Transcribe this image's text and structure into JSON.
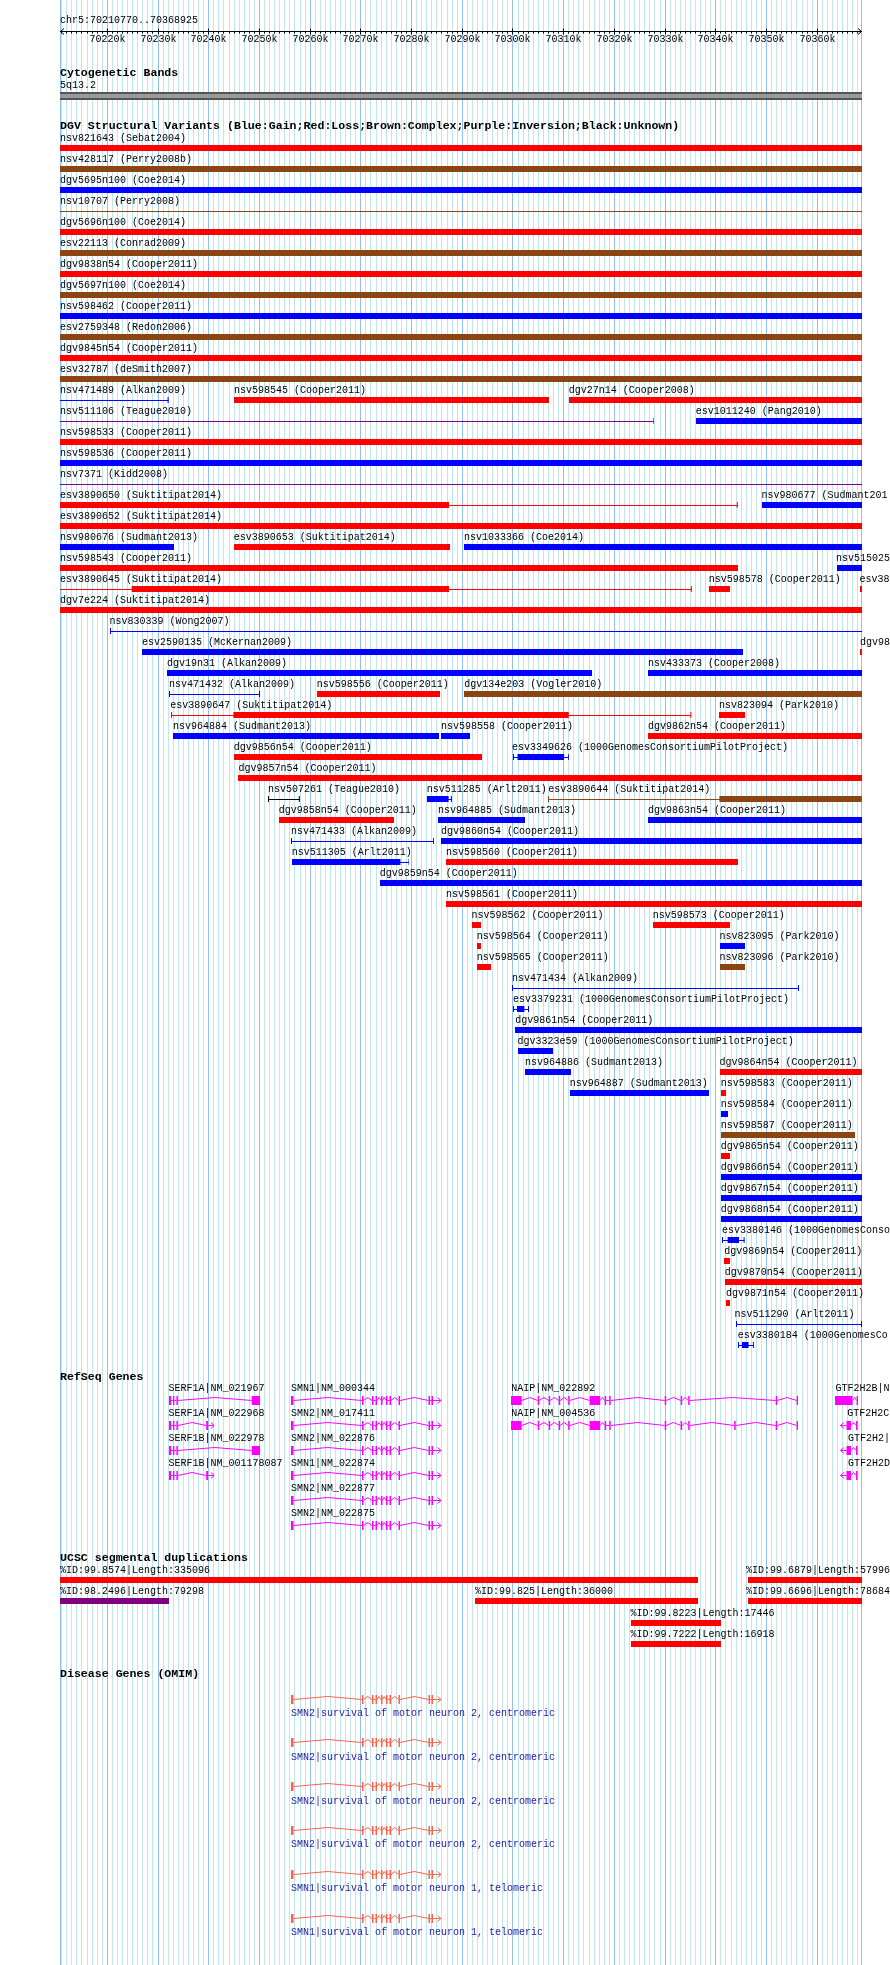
{
  "ruler": {
    "region": "chr5:70210770..70368925",
    "ticks": [
      "70220k",
      "70230k",
      "70240k",
      "70250k",
      "70260k",
      "70270k",
      "70280k",
      "70290k",
      "70300k",
      "70310k",
      "70320k",
      "70330k",
      "70340k",
      "70350k",
      "70360k"
    ]
  },
  "tracks": [
    {
      "kind": "cytoband",
      "title": "Cytogenetic Bands",
      "band": "5q13.2"
    },
    {
      "kind": "variants",
      "title": "DGV Structural Variants (Blue:Gain;Red:Loss;Brown:Complex;Purple:Inversion;Black:Unknown)",
      "rows": [
        {
          "features": [
            {
              "label": "nsv821643 (Sebat2004)",
              "kind": "bar",
              "color": "#ff0000"
            }
          ]
        },
        {
          "features": [
            {
              "label": "nsv428117 (Perry2008b)",
              "kind": "bar",
              "color": "#8b4513"
            }
          ]
        },
        {
          "features": [
            {
              "label": "dgv5695n100 (Coe2014)",
              "kind": "bar",
              "color": "#0000ff"
            }
          ]
        },
        {
          "features": [
            {
              "label": "nsv10707 (Perry2008)",
              "kind": "line",
              "color": "#8b4513"
            }
          ]
        },
        {
          "features": [
            {
              "label": "dgv5696n100 (Coe2014)",
              "kind": "bar",
              "color": "#ff0000"
            }
          ]
        },
        {
          "features": [
            {
              "label": "esv22113 (Conrad2009)",
              "kind": "bar",
              "color": "#8b4513"
            }
          ]
        },
        {
          "features": [
            {
              "label": "dgv9838n54 (Cooper2011)",
              "kind": "bar",
              "color": "#ff0000"
            }
          ]
        },
        {
          "features": [
            {
              "label": "dgv5697n100 (Coe2014)",
              "kind": "bar",
              "color": "#8b4513"
            }
          ]
        },
        {
          "features": [
            {
              "label": "nsv598462 (Cooper2011)",
              "kind": "bar",
              "color": "#0000ff"
            }
          ]
        },
        {
          "features": [
            {
              "label": "esv2759348 (Redon2006)",
              "kind": "bar",
              "color": "#8b4513"
            }
          ]
        },
        {
          "features": [
            {
              "label": "dgv9845n54 (Cooper2011)",
              "kind": "bar",
              "color": "#ff0000"
            }
          ]
        },
        {
          "features": [
            {
              "label": "esv32787 (deSmith2007)",
              "kind": "bar",
              "color": "#8b4513"
            }
          ]
        },
        {
          "features": [
            {
              "label": "nsv471489 (Alkan2009)",
              "kind": "line",
              "color": "#0000ff"
            },
            {
              "label": "nsv598545 (Cooper2011)",
              "kind": "bar",
              "color": "#ff0000"
            },
            {
              "label": "dgv27n14 (Cooper2008)",
              "kind": "bar",
              "color": "#ff0000"
            }
          ]
        },
        {
          "features": [
            {
              "label": "nsv511106 (Teague2010)",
              "kind": "line",
              "color": "#800080"
            },
            {
              "label": "esv1011240 (Pang2010)",
              "kind": "bar",
              "color": "#0000ff"
            }
          ]
        },
        {
          "features": [
            {
              "label": "nsv598533 (Cooper2011)",
              "kind": "bar",
              "color": "#ff0000"
            }
          ]
        },
        {
          "features": [
            {
              "label": "nsv598536 (Cooper2011)",
              "kind": "bar",
              "color": "#0000ff"
            }
          ]
        },
        {
          "features": [
            {
              "label": "nsv7371 (Kidd2008)",
              "kind": "line",
              "color": "#800080"
            }
          ]
        },
        {
          "features": [
            {
              "label": "esv3890650 (Suktitipat2014)",
              "kind": "partial",
              "color": "#ff0000"
            },
            {
              "label": "nsv980677 (Sudmant201",
              "kind": "bar",
              "color": "#0000ff"
            }
          ]
        },
        {
          "features": [
            {
              "label": "esv3890652 (Suktitipat2014)",
              "kind": "bar",
              "color": "#ff0000"
            }
          ]
        },
        {
          "features": [
            {
              "label": "nsv980676 (Sudmant2013)",
              "kind": "bar",
              "color": "#0000ff"
            },
            {
              "label": "esv3890653 (Suktitipat2014)",
              "kind": "bar",
              "color": "#ff0000"
            },
            {
              "label": "nsv1033366 (Coe2014)",
              "kind": "bar",
              "color": "#0000ff"
            }
          ]
        },
        {
          "features": [
            {
              "label": "nsv598543 (Cooper2011)",
              "kind": "bar",
              "color": "#ff0000"
            },
            {
              "label": "nsv515025",
              "kind": "bar",
              "color": "#0000ff"
            }
          ]
        },
        {
          "features": [
            {
              "label": "esv3890645 (Suktitipat2014)",
              "kind": "partial",
              "color": "#ff0000"
            },
            {
              "label": "nsv598578 (Cooper2011)",
              "kind": "bar",
              "color": "#ff0000"
            },
            {
              "label": "esv38",
              "kind": "bar",
              "color": "#ff0000"
            }
          ]
        },
        {
          "features": [
            {
              "label": "dgv7e224 (Suktitipat2014)",
              "kind": "bar",
              "color": "#ff0000"
            }
          ]
        },
        {
          "features": [
            {
              "label": "nsv830339 (Wong2007)",
              "kind": "line",
              "color": "#0000ff"
            }
          ]
        },
        {
          "features": [
            {
              "label": "esv2590135 (McKernan2009)",
              "kind": "bar",
              "color": "#0000ff"
            },
            {
              "label": "dgv98",
              "kind": "bar",
              "color": "#ff0000"
            }
          ]
        },
        {
          "features": [
            {
              "label": "dgv19n31 (Alkan2009)",
              "kind": "bar",
              "color": "#0000ff"
            },
            {
              "label": "nsv433373 (Cooper2008)",
              "kind": "bar",
              "color": "#0000ff"
            }
          ]
        },
        {
          "features": [
            {
              "label": "nsv471432 (Alkan2009)",
              "kind": "line",
              "color": "#0000ff"
            },
            {
              "label": "nsv598556 (Cooper2011)",
              "kind": "bar",
              "color": "#ff0000"
            },
            {
              "label": "dgv134e203 (Vogler2010)",
              "kind": "bar",
              "color": "#8b4513"
            }
          ]
        },
        {
          "features": [
            {
              "label": "esv3890647 (Suktitipat2014)",
              "kind": "partial",
              "color": "#ff0000"
            },
            {
              "label": "nsv823094 (Park2010)",
              "kind": "bar",
              "color": "#ff0000"
            }
          ]
        },
        {
          "features": [
            {
              "label": "nsv964884 (Sudmant2013)",
              "kind": "bar",
              "color": "#0000ff"
            },
            {
              "label": "nsv598558 (Cooper2011)",
              "kind": "bar",
              "color": "#0000ff"
            },
            {
              "label": "dgv9862n54 (Cooper2011)",
              "kind": "bar",
              "color": "#ff0000"
            }
          ]
        },
        {
          "features": [
            {
              "label": "dgv9856n54 (Cooper2011)",
              "kind": "bar",
              "color": "#ff0000"
            },
            {
              "label": "esv3349626 (1000GenomesConsortiumPilotProject)",
              "kind": "partial",
              "color": "#0000ff"
            }
          ]
        },
        {
          "features": [
            {
              "label": "dgv9857n54 (Cooper2011)",
              "kind": "bar",
              "color": "#ff0000"
            }
          ]
        },
        {
          "features": [
            {
              "label": "nsv507261 (Teague2010)",
              "kind": "line",
              "color": "#000000"
            },
            {
              "label": "nsv511285 (Arlt2011)",
              "kind": "partial",
              "color": "#0000ff"
            },
            {
              "label": "esv3890644 (Suktitipat2014)",
              "kind": "partial",
              "color": "#8b4513"
            }
          ]
        },
        {
          "features": [
            {
              "label": "dgv9858n54 (Cooper2011)",
              "kind": "bar",
              "color": "#ff0000"
            },
            {
              "label": "nsv964885 (Sudmant2013)",
              "kind": "bar",
              "color": "#0000ff"
            },
            {
              "label": "dgv9863n54 (Cooper2011)",
              "kind": "bar",
              "color": "#0000ff"
            }
          ]
        },
        {
          "features": [
            {
              "label": "nsv471433 (Alkan2009)",
              "kind": "line",
              "color": "#0000ff"
            },
            {
              "label": "dgv9860n54 (Cooper2011)",
              "kind": "bar",
              "color": "#0000ff"
            }
          ]
        },
        {
          "features": [
            {
              "label": "nsv511305 (Arlt2011)",
              "kind": "partial",
              "color": "#0000ff"
            },
            {
              "label": "nsv598560 (Cooper2011)",
              "kind": "bar",
              "color": "#ff0000"
            }
          ]
        },
        {
          "features": [
            {
              "label": "dgv9859n54 (Cooper2011)",
              "kind": "bar",
              "color": "#0000ff"
            }
          ]
        },
        {
          "features": [
            {
              "label": "nsv598561 (Cooper2011)",
              "kind": "bar",
              "color": "#ff0000"
            }
          ]
        },
        {
          "features": [
            {
              "label": "nsv598562 (Cooper2011)",
              "kind": "bar",
              "color": "#ff0000"
            },
            {
              "label": "nsv598573 (Cooper2011)",
              "kind": "bar",
              "color": "#ff0000"
            }
          ]
        },
        {
          "features": [
            {
              "label": "nsv598564 (Cooper2011)",
              "kind": "bar",
              "color": "#ff0000"
            },
            {
              "label": "nsv823095 (Park2010)",
              "kind": "bar",
              "color": "#0000ff"
            }
          ]
        },
        {
          "features": [
            {
              "label": "nsv598565 (Cooper2011)",
              "kind": "bar",
              "color": "#ff0000"
            },
            {
              "label": "nsv823096 (Park2010)",
              "kind": "bar",
              "color": "#8b4513"
            }
          ]
        },
        {
          "features": [
            {
              "label": "nsv471434 (Alkan2009)",
              "kind": "line",
              "color": "#0000ff"
            }
          ]
        },
        {
          "features": [
            {
              "label": "esv3379231 (1000GenomesConsortiumPilotProject)",
              "kind": "partial",
              "color": "#0000ff"
            }
          ]
        },
        {
          "features": [
            {
              "label": "dgv9861n54 (Cooper2011)",
              "kind": "bar",
              "color": "#0000ff"
            }
          ]
        },
        {
          "features": [
            {
              "label": "dgv3323e59 (1000GenomesConsortiumPilotProject)",
              "kind": "bar",
              "color": "#0000ff"
            }
          ]
        },
        {
          "features": [
            {
              "label": "nsv964886 (Sudmant2013)",
              "kind": "bar",
              "color": "#0000ff"
            },
            {
              "label": "dgv9864n54 (Cooper2011)",
              "kind": "bar",
              "color": "#ff0000"
            }
          ]
        },
        {
          "features": [
            {
              "label": "nsv964887 (Sudmant2013)",
              "kind": "bar",
              "color": "#0000ff"
            },
            {
              "label": "nsv598583 (Cooper2011)",
              "kind": "bar",
              "color": "#ff0000"
            }
          ]
        },
        {
          "features": [
            {
              "label": "nsv598584 (Cooper2011)",
              "kind": "bar",
              "color": "#0000ff"
            }
          ]
        },
        {
          "features": [
            {
              "label": "nsv598587 (Cooper2011)",
              "kind": "bar",
              "color": "#8b4513"
            }
          ]
        },
        {
          "features": [
            {
              "label": "dgv9865n54 (Cooper2011)",
              "kind": "bar",
              "color": "#ff0000"
            }
          ]
        },
        {
          "features": [
            {
              "label": "dgv9866n54 (Cooper2011)",
              "kind": "bar",
              "color": "#0000ff"
            }
          ]
        },
        {
          "features": [
            {
              "label": "dgv9867n54 (Cooper2011)",
              "kind": "bar",
              "color": "#0000ff"
            }
          ]
        },
        {
          "features": [
            {
              "label": "dgv9868n54 (Cooper2011)",
              "kind": "bar",
              "color": "#0000ff"
            }
          ]
        },
        {
          "features": [
            {
              "label": "esv3380146 (1000GenomesConso",
              "kind": "partial",
              "color": "#0000ff"
            }
          ]
        },
        {
          "features": [
            {
              "label": "dgv9869n54 (Cooper2011)",
              "kind": "bar",
              "color": "#ff0000"
            }
          ]
        },
        {
          "features": [
            {
              "label": "dgv9870n54 (Cooper2011)",
              "kind": "bar",
              "color": "#ff0000"
            }
          ]
        },
        {
          "features": [
            {
              "label": "dgv9871n54 (Cooper2011)",
              "kind": "bar",
              "color": "#ff0000"
            }
          ]
        },
        {
          "features": [
            {
              "label": "nsv511290 (Arlt2011)",
              "kind": "line",
              "color": "#0000ff"
            }
          ]
        },
        {
          "features": [
            {
              "label": "esv3380184 (1000GenomesCo",
              "kind": "partial",
              "color": "#0000ff"
            }
          ]
        }
      ]
    },
    {
      "kind": "genes",
      "title": "RefSeq Genes",
      "rows": [
        {
          "features": [
            {
              "label": "SERF1A|NM_021967"
            },
            {
              "label": "SMN1|NM_000344"
            },
            {
              "label": "NAIP|NM_022892"
            },
            {
              "label": "GTF2H2B|N"
            }
          ]
        },
        {
          "features": [
            {
              "label": "SERF1A|NM_022968"
            },
            {
              "label": "SMN2|NM_017411"
            },
            {
              "label": "NAIP|NM_004536"
            },
            {
              "label": "GTF2H2C"
            }
          ]
        },
        {
          "features": [
            {
              "label": "SERF1B|NM_022978"
            },
            {
              "label": "SMN2|NM_022876"
            },
            {
              "label": "GTF2H2|"
            }
          ]
        },
        {
          "features": [
            {
              "label": "SERF1B|NM_001178087"
            },
            {
              "label": "SMN1|NM_022874"
            },
            {
              "label": "GTF2H2D"
            }
          ]
        },
        {
          "features": [
            {
              "label": "SMN2|NM_022877"
            }
          ]
        },
        {
          "features": [
            {
              "label": "SMN2|NM_022875"
            }
          ]
        }
      ]
    },
    {
      "kind": "segdups",
      "title": "UCSC segmental duplications",
      "rows": [
        {
          "features": [
            {
              "label": "%ID:99.8574|Length:335096",
              "color": "#ff0000"
            },
            {
              "label": "%ID:99.6879|Length:57996",
              "color": "#ff0000"
            }
          ]
        },
        {
          "features": [
            {
              "label": "%ID:98.2496|Length:79298",
              "color": "#800080"
            },
            {
              "label": "%ID:99.825|Length:36000",
              "color": "#ff0000"
            },
            {
              "label": "%ID:99.6696|Length:78684",
              "color": "#ff0000"
            }
          ]
        },
        {
          "features": [
            {
              "label": "%ID:99.8223|Length:17446",
              "color": "#ff0000"
            }
          ]
        },
        {
          "features": [
            {
              "label": "%ID:99.7222|Length:16918",
              "color": "#ff0000"
            }
          ]
        }
      ]
    },
    {
      "kind": "omim",
      "title": "Disease Genes (OMIM)",
      "rows": [
        {
          "label": "SMN2|survival of motor neuron 2, centromeric"
        },
        {
          "label": "SMN2|survival of motor neuron 2, centromeric"
        },
        {
          "label": "SMN2|survival of motor neuron 2, centromeric"
        },
        {
          "label": "SMN2|survival of motor neuron 2, centromeric"
        },
        {
          "label": "SMN1|survival of motor neuron 1, telomeric"
        },
        {
          "label": "SMN1|survival of motor neuron 1, telomeric"
        }
      ]
    }
  ]
}
